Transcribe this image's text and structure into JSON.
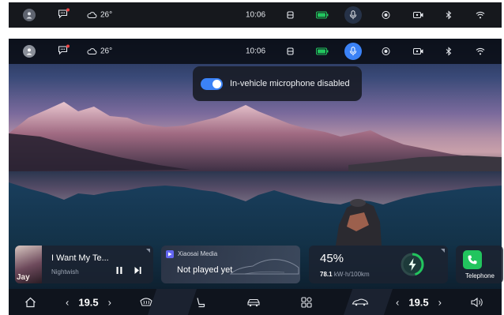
{
  "status_bar": {
    "weather_temp": "26°",
    "time": "10:06"
  },
  "toast": {
    "message": "In-vehicle microphone disabled",
    "toggle_on": true
  },
  "music_card": {
    "album_text": "Jay",
    "song_title": "I Want My Te...",
    "artist": "Nightwish"
  },
  "media_card": {
    "app_name": "Xiaosai Media",
    "status": "Not played yet"
  },
  "energy_card": {
    "battery_percent": "45%",
    "efficiency_value": "78.1",
    "efficiency_unit": "kW·h/100km"
  },
  "phone_card": {
    "label": "Telephone"
  },
  "bottom_bar": {
    "left_temp": "19.5",
    "right_temp": "19.5"
  },
  "colors": {
    "accent_blue": "#3b82f6",
    "battery_green": "#22c55e",
    "phone_green": "#22c55e"
  }
}
